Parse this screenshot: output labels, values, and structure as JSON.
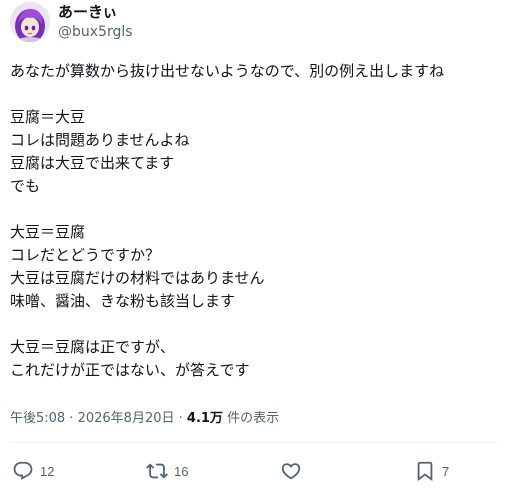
{
  "author": {
    "display_name": "あーきぃ",
    "handle": "@bux5rgls",
    "avatar_icon": "anime-avatar-icon",
    "avatar_colors": {
      "hair": "#8a3fc7",
      "face": "#f3e3d8",
      "background": "#e9e4ef"
    }
  },
  "tweet": {
    "lines": [
      "あなたが算数から抜け出せないようなので、別の例え出しますね",
      "",
      "豆腐＝大豆",
      "コレは問題ありませんよね",
      "豆腐は大豆で出来てます",
      "でも",
      "",
      "大豆＝豆腐",
      "コレだとどうですか？",
      "大豆は豆腐だけの材料ではありません",
      "味噌、醤油、きな粉も該当します",
      "",
      "大豆＝豆腐は正ですが、",
      "これだけが正ではない、が答えです"
    ]
  },
  "meta": {
    "time": "午後5:08 · 2026年8月20日",
    "separator": " · ",
    "views_count": "4.1万",
    "views_label": " 件の表示"
  },
  "actions": {
    "reply_count": "12",
    "retweet_count": "16",
    "like_count": "",
    "bookmark_count": "7",
    "icons": [
      "reply-icon",
      "retweet-icon",
      "like-icon",
      "bookmark-icon"
    ],
    "icon_color": "#536471"
  }
}
